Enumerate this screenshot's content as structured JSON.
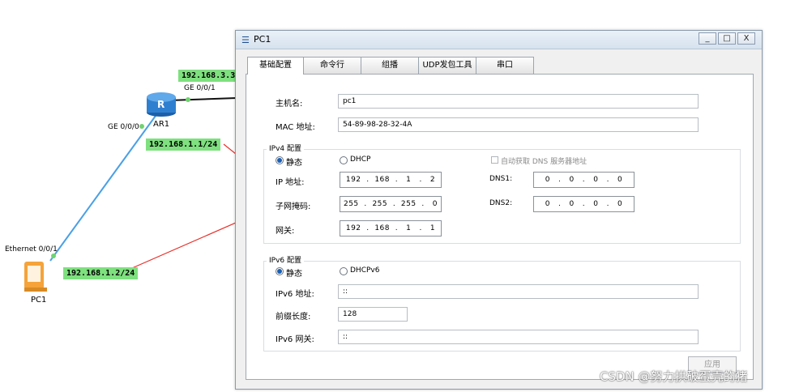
{
  "topology": {
    "router_name": "AR1",
    "router_badge": "R",
    "pc_name": "PC1",
    "router_port_top": "GE 0/0/1",
    "router_port_left": "GE 0/0/0",
    "pc_port": "Ethernet 0/0/1",
    "ip_top": "192.168.3.3",
    "ip_router_ge0": "192.168.1.1/24",
    "ip_pc": "192.168.1.2/24"
  },
  "window": {
    "title": "PC1",
    "buttons": {
      "minimize": "_",
      "maximize": "□",
      "close": "X"
    },
    "tabs": [
      {
        "label": "基础配置",
        "active": true
      },
      {
        "label": "命令行",
        "active": false
      },
      {
        "label": "组播",
        "active": false
      },
      {
        "label": "UDP发包工具",
        "active": false
      },
      {
        "label": "串口",
        "active": false
      }
    ],
    "basic": {
      "hostname_label": "主机名:",
      "hostname_value": "pc1",
      "mac_label": "MAC 地址:",
      "mac_value": "54-89-98-28-32-4A"
    },
    "ipv4": {
      "group_title": "IPv4 配置",
      "static_label": "静态",
      "dhcp_label": "DHCP",
      "mode": "static",
      "auto_dns_label": "自动获取 DNS 服务器地址",
      "ip_label": "IP 地址:",
      "ip_value": "192  .  168  .   1   .   2",
      "mask_label": "子网掩码:",
      "mask_value": "255  .  255  .  255  .   0",
      "gateway_label": "网关:",
      "gateway_value": "192  .  168  .   1   .   1",
      "dns1_label": "DNS1:",
      "dns1_value": "0   .   0   .   0   .   0",
      "dns2_label": "DNS2:",
      "dns2_value": "0   .   0   .   0   .   0"
    },
    "ipv6": {
      "group_title": "IPv6 配置",
      "static_label": "静态",
      "dhcp_label": "DHCPv6",
      "mode": "static",
      "ip_label": "IPv6 地址:",
      "ip_value": "::",
      "prefix_label": "前缀长度:",
      "prefix_value": "128",
      "gateway_label": "IPv6 网关:",
      "gateway_value": "::"
    },
    "apply_label": "应用"
  },
  "watermark": "CSDN @努力拱破蛋壳的猪",
  "colors": {
    "ip_label_bg": "#7ee07e",
    "link_blue": "#4aa0e6",
    "link_black": "#111111",
    "annotation_red": "#e8312b",
    "router_blue": "#2f7fd0"
  }
}
